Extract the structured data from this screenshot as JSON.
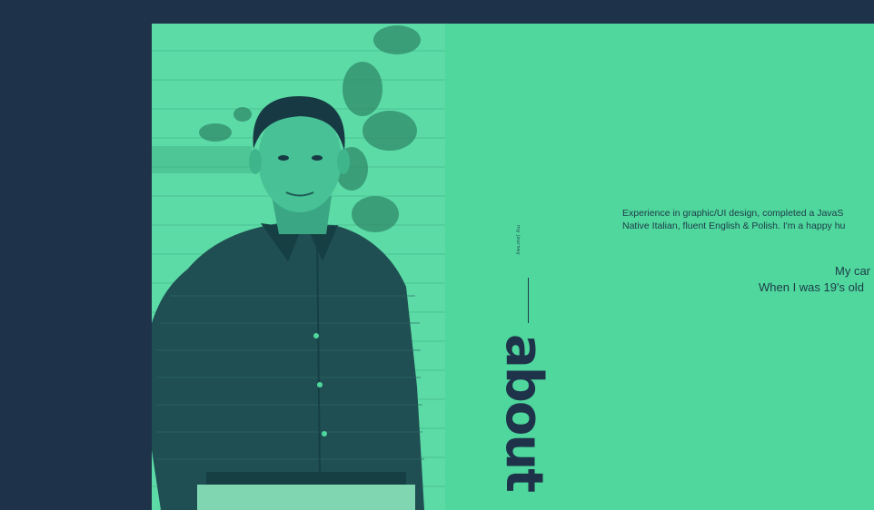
{
  "section": {
    "label": "about",
    "small_label": "my journey"
  },
  "intro": {
    "line1": "Experience in graphic/UI design, completed a JavaS",
    "line2": "Native Italian, fluent English & Polish. I'm a happy hu"
  },
  "career": {
    "line1": "My car",
    "line2": "When I was 19's old"
  },
  "colors": {
    "background": "#1e3249",
    "accent_green": "#4fd79d",
    "photo_tint": "#5bd9a4",
    "text_dark": "#1e3249"
  }
}
